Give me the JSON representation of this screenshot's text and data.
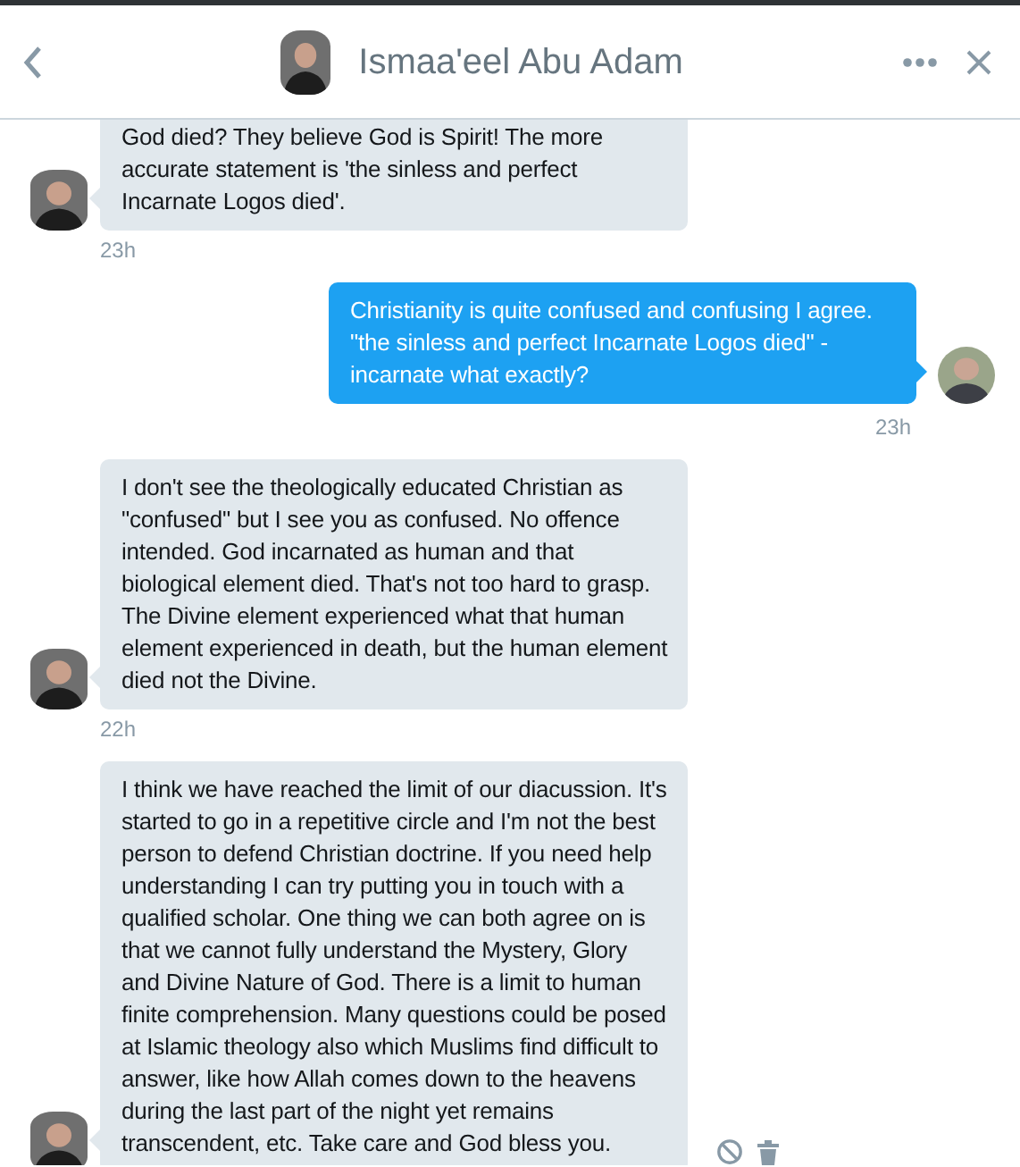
{
  "header": {
    "title": "Ismaa'eel Abu Adam"
  },
  "messages": [
    {
      "kind": "incoming",
      "text": "God died? They believe God is Spirit! The more accurate statement is 'the sinless and perfect  Incarnate Logos died'.",
      "time": "23h",
      "cut_top": true
    },
    {
      "kind": "outgoing",
      "text": "Christianity is quite confused and confusing I agree. \"the sinless and perfect  Incarnate Logos died\" - incarnate what exactly?",
      "time": "23h",
      "cut_top": false
    },
    {
      "kind": "incoming",
      "text": "I don't see the theologically educated Christian as \"confused\" but I see you as confused. No offence intended. God incarnated as human and that biological element died. That's not too hard to grasp. The Divine element experienced what that human element experienced in death, but the human element died not the Divine.",
      "time": "22h",
      "cut_top": false
    },
    {
      "kind": "incoming",
      "text": "I think we have reached the limit of our diacussion. It's started to go in a repetitive circle and I'm not the best person to defend Christian doctrine. If you need help understanding I can try putting you in touch with a qualified scholar. One thing we can both agree on is that we cannot fully understand the Mystery, Glory and Divine Nature of God. There is a limit to human finite comprehension. Many questions could be posed at Islamic theology also which Muslims find difficult to answer, like how Allah comes down to the heavens during the last part of the night yet remains transcendent, etc. Take care and God bless you.",
      "cut_top": false,
      "show_actions": true
    }
  ]
}
